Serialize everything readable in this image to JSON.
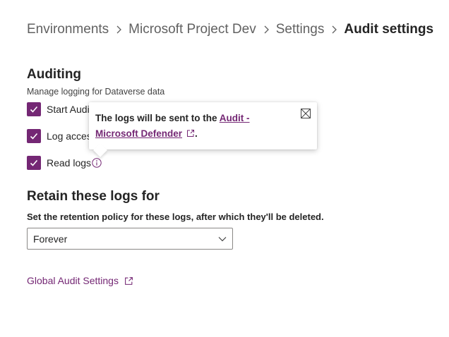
{
  "breadcrumb": {
    "items": [
      "Environments",
      "Microsoft Project Dev",
      "Settings"
    ],
    "current": "Audit settings",
    "separator": ">"
  },
  "auditing": {
    "title": "Auditing",
    "subtitle": "Manage logging for Dataverse data",
    "checkboxes": [
      {
        "label": "Start Audi",
        "checked": true
      },
      {
        "label": "Log acces",
        "checked": true
      },
      {
        "label": "Read logs",
        "checked": true
      }
    ]
  },
  "tooltip": {
    "text_before": "The logs will be sent to the ",
    "link_text": "Audit - Microsoft Defender",
    "text_after": "."
  },
  "retention": {
    "title": "Retain these logs for",
    "description": "Set the retention policy for these logs, after which they'll be deleted.",
    "selected": "Forever"
  },
  "global_link": "Global Audit Settings",
  "colors": {
    "accent": "#742774",
    "text": "#242424",
    "muted": "#616161",
    "border": "#8a8886"
  },
  "icons": {
    "checkbox": "checkmark-icon",
    "info": "info-icon",
    "close": "close-icon",
    "external": "external-link-icon",
    "chevron": "chevron-down-icon"
  }
}
